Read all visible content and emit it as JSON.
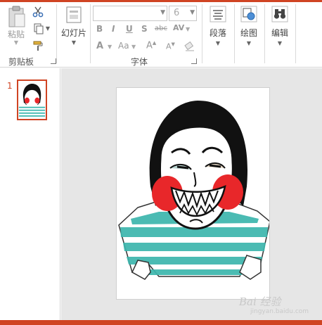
{
  "ribbon": {
    "clipboard": {
      "paste_label": "粘贴",
      "group_label": "剪贴板"
    },
    "slides": {
      "slides_label": "幻灯片"
    },
    "font": {
      "font_name": "",
      "font_size": "6",
      "group_label": "字体"
    },
    "paragraph": {
      "label": "段落"
    },
    "drawing": {
      "label": "绘图"
    },
    "editing": {
      "label": "编辑"
    }
  },
  "slides_pane": {
    "slide_number": "1"
  },
  "watermark": {
    "text": "Bai 经验",
    "url": "jingyan.baidu.com"
  },
  "colors": {
    "accent": "#d04423",
    "workspace": "#e6e6e6",
    "shirt_stripe": "#3cb6ad",
    "blush": "#e8272a"
  }
}
